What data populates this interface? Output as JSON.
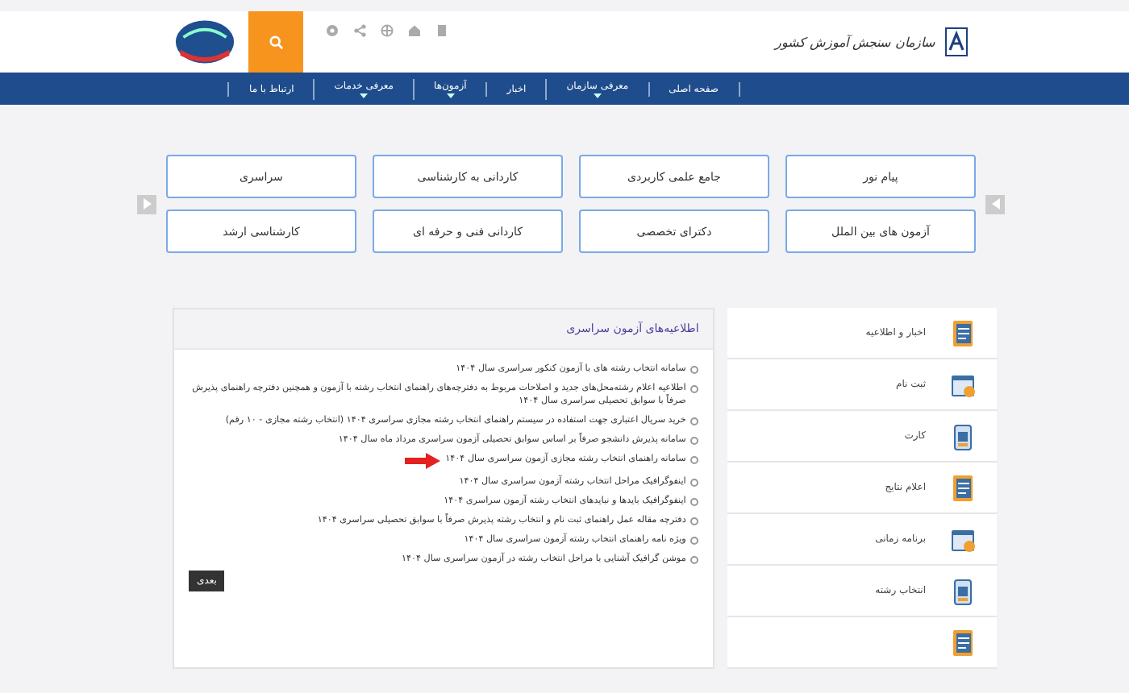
{
  "header": {
    "org_name": "سازمان سنجش آموزش کشور"
  },
  "nav": [
    {
      "label": "صفحه اصلی",
      "has_menu": false
    },
    {
      "label": "معرفی سازمان",
      "has_menu": true
    },
    {
      "label": "اخبار",
      "has_menu": false
    },
    {
      "label": "آزمون‌ها",
      "has_menu": true
    },
    {
      "label": "معرفی خدمات",
      "has_menu": true
    },
    {
      "label": "ارتباط با ما",
      "has_menu": false
    }
  ],
  "exam_buttons": [
    "پیام نور",
    "جامع علمی کاربردی",
    "کاردانی به کارشناسی",
    "سراسری",
    "آزمون های بین الملل",
    "دکترای تخصصی",
    "کاردانی فنی و حرفه ای",
    "کارشناسی ارشد"
  ],
  "notices": {
    "title": "اطلاعیه‌های آزمون سراسری",
    "items": [
      {
        "text": "سامانه انتخاب رشته های با آزمون کنکور سراسری سال ۱۴۰۴",
        "marked": false
      },
      {
        "text": "اطلاعیه اعلام رشته‌محل‌های جدید و اصلاحات مربوط به دفترچه‌های راهنمای انتخاب رشته با آزمون و همچنین دفترچه راهنمای پذیرش صرفاً با سوابق تحصیلی سراسری سال ۱۴۰۴",
        "marked": false
      },
      {
        "text": "خرید سریال اعتباری جهت استفاده در سیستم راهنمای انتخاب رشته مجازی سراسری ۱۴۰۴ (انتخاب رشته مجازی - ۱۰ رقم)",
        "marked": false
      },
      {
        "text": "سامانه پذیرش دانشجو صرفاً بر اساس سوابق تحصیلی آزمون سراسری مرداد ماه سال ۱۴۰۴",
        "marked": false
      },
      {
        "text": "سامانه راهنمای انتخاب رشته مجازی آزمون سراسری سال ۱۴۰۴",
        "marked": true
      },
      {
        "text": "اینفوگرافیک مراحل انتخاب رشته آزمون سراسری سال ۱۴۰۴",
        "marked": false
      },
      {
        "text": "اینفوگرافیک بایدها و نبایدهای انتخاب رشته آزمون سراسری ۱۴۰۴",
        "marked": false
      },
      {
        "text": "دفترچه مقاله عمل راهنمای ثبت نام و انتخاب رشته پذیرش صرفاً با سوابق تحصیلی سراسری ۱۴۰۴",
        "marked": false
      },
      {
        "text": "ویژه نامه راهنمای انتخاب رشته آزمون سراسری سال ۱۴۰۴",
        "marked": false
      },
      {
        "text": "موشن گرافیک آشنایی با مراحل انتخاب رشته در آزمون سراسری سال ۱۴۰۴",
        "marked": false
      }
    ],
    "next_button": "بعدی"
  },
  "sidebar": [
    {
      "kind": "entry",
      "label": "اخبار و اطلاعیه"
    },
    {
      "kind": "entry",
      "label": "ثبت نام"
    },
    {
      "kind": "entry",
      "label": "کارت"
    },
    {
      "kind": "entry",
      "label": "اعلام نتایج"
    },
    {
      "kind": "entry",
      "label": "برنامه زمانی"
    },
    {
      "kind": "entry",
      "label": "انتخاب رشته"
    },
    {
      "kind": "cut"
    }
  ]
}
